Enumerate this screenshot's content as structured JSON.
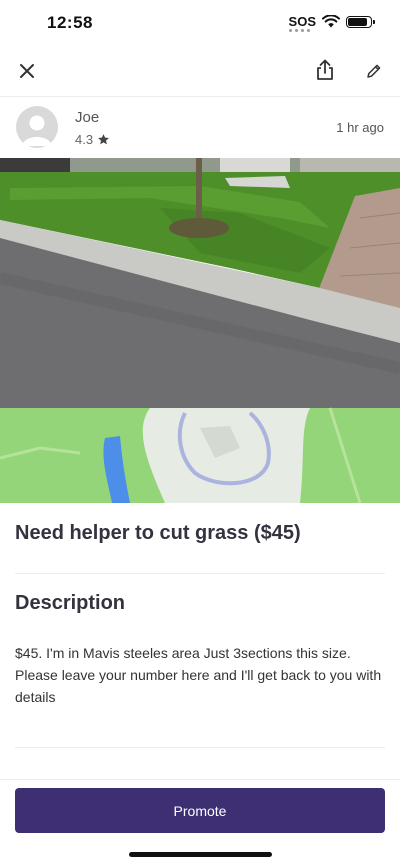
{
  "status_bar": {
    "time": "12:58",
    "sos": "SOS",
    "battery_level": 0.85
  },
  "author": {
    "name": "Joe",
    "rating": "4.3",
    "posted": "1 hr ago"
  },
  "post": {
    "title": "Need helper to cut grass ($45)",
    "description_heading": "Description",
    "description": "$45. I'm in Mavis steeles area Just 3sections this size. Please leave your number here and I'll get back to you with details"
  },
  "actions": {
    "promote_label": "Promote"
  },
  "icons": {
    "close": "close-icon",
    "share": "share-icon",
    "edit": "pencil-icon",
    "rating": "star-icon"
  },
  "colors": {
    "primary": "#3d2f72",
    "text": "#33333f"
  }
}
